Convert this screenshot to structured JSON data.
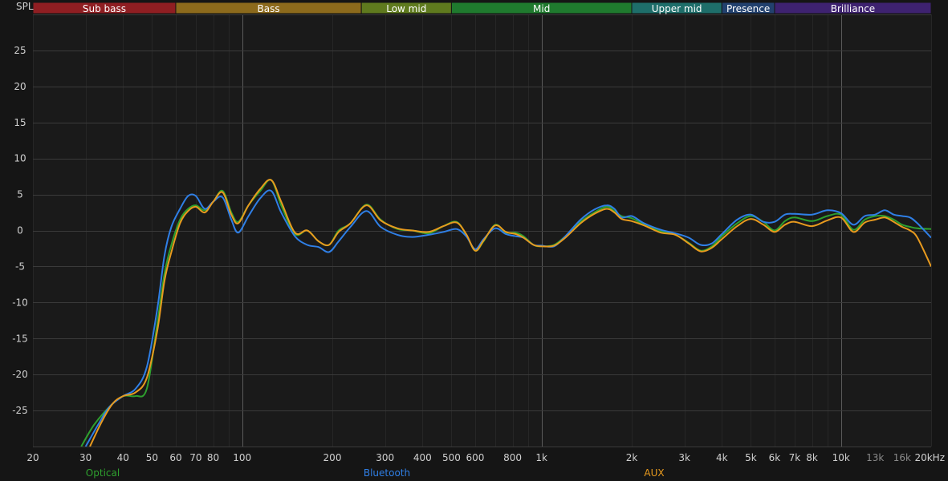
{
  "colors": {
    "background": "#151515",
    "plot_background": "#1a1a1a",
    "grid_major": "#3a3a3a",
    "grid_minor": "#262626",
    "decade_line": "#5a5a5a"
  },
  "chart_data": {
    "type": "line",
    "ylabel": "SPL",
    "xscale": "log",
    "xlim": [
      20,
      20000
    ],
    "ylim": [
      -30,
      30
    ],
    "grid": true,
    "legend_position": "bottom",
    "y_ticks": [
      25,
      20,
      15,
      10,
      5,
      0,
      -5,
      -10,
      -15,
      -20,
      -25
    ],
    "x_ticks": [
      {
        "value": 20,
        "label": "20"
      },
      {
        "value": 30,
        "label": "30"
      },
      {
        "value": 40,
        "label": "40"
      },
      {
        "value": 50,
        "label": "50"
      },
      {
        "value": 60,
        "label": "60"
      },
      {
        "value": 70,
        "label": "70"
      },
      {
        "value": 80,
        "label": "80"
      },
      {
        "value": 100,
        "label": "100"
      },
      {
        "value": 200,
        "label": "200"
      },
      {
        "value": 300,
        "label": "300"
      },
      {
        "value": 400,
        "label": "400"
      },
      {
        "value": 500,
        "label": "500"
      },
      {
        "value": 600,
        "label": "600"
      },
      {
        "value": 800,
        "label": "800"
      },
      {
        "value": 1000,
        "label": "1k"
      },
      {
        "value": 2000,
        "label": "2k"
      },
      {
        "value": 3000,
        "label": "3k"
      },
      {
        "value": 4000,
        "label": "4k"
      },
      {
        "value": 5000,
        "label": "5k"
      },
      {
        "value": 6000,
        "label": "6k"
      },
      {
        "value": 7000,
        "label": "7k"
      },
      {
        "value": 8000,
        "label": "8k"
      },
      {
        "value": 10000,
        "label": "10k"
      },
      {
        "value": 13000,
        "label": "13k",
        "dim": true
      },
      {
        "value": 16000,
        "label": "16k",
        "dim": true
      },
      {
        "value": 20000,
        "label": "20kHz"
      }
    ],
    "bands": [
      {
        "label": "Sub bass",
        "from": 20,
        "to": 60,
        "color": "#8f1e22"
      },
      {
        "label": "Bass",
        "from": 60,
        "to": 250,
        "color": "#8c6a1c"
      },
      {
        "label": "Low mid",
        "from": 250,
        "to": 500,
        "color": "#5f7a1e"
      },
      {
        "label": "Mid",
        "from": 500,
        "to": 2000,
        "color": "#1f7a2e"
      },
      {
        "label": "Upper mid",
        "from": 2000,
        "to": 4000,
        "color": "#1e6e6a"
      },
      {
        "label": "Presence",
        "from": 4000,
        "to": 6000,
        "color": "#22416e"
      },
      {
        "label": "Brilliance",
        "from": 6000,
        "to": 20000,
        "color": "#3e2270"
      }
    ],
    "series": [
      {
        "name": "Optical",
        "color": "#2ea02e",
        "x": [
          29,
          32,
          36,
          40,
          44,
          48,
          52,
          55,
          58,
          62,
          66,
          70,
          75,
          80,
          86,
          92,
          97,
          105,
          115,
          125,
          135,
          150,
          165,
          180,
          195,
          210,
          230,
          260,
          290,
          330,
          370,
          420,
          470,
          520,
          560,
          600,
          640,
          700,
          760,
          820,
          870,
          940,
          1000,
          1100,
          1200,
          1350,
          1500,
          1650,
          1750,
          1850,
          2000,
          2200,
          2500,
          2800,
          3100,
          3400,
          3700,
          4000,
          4500,
          5000,
          5500,
          6000,
          6500,
          7000,
          8000,
          9000,
          10000,
          11000,
          12000,
          13000,
          14000,
          15000,
          16000,
          17000,
          18000,
          20000
        ],
        "y": [
          -30,
          -27,
          -24.5,
          -23,
          -23,
          -22,
          -13,
          -6,
          -2,
          1.5,
          3,
          3.5,
          2.8,
          4,
          5.5,
          2.5,
          1.2,
          3.5,
          5.5,
          7,
          3.5,
          -0.5,
          0,
          -1.5,
          -2,
          0,
          1,
          3.6,
          1.5,
          0.2,
          0,
          -0.4,
          0.6,
          1.2,
          -0.6,
          -2.8,
          -1.5,
          0.8,
          -0.3,
          -0.3,
          -0.8,
          -2,
          -2.2,
          -2,
          -0.8,
          1.2,
          2.5,
          3.3,
          2.7,
          2,
          1.7,
          0.8,
          -0.1,
          -0.6,
          -1.7,
          -2.8,
          -2.2,
          -0.8,
          1,
          2,
          1.2,
          0,
          1.3,
          1.8,
          1.3,
          2,
          2.2,
          0.1,
          1.5,
          2,
          2,
          1.5,
          0.8,
          0.5,
          0.3,
          0.2
        ]
      },
      {
        "name": "Bluetooth",
        "color": "#2f7fe6",
        "x": [
          30,
          33,
          36,
          40,
          44,
          48,
          52,
          55,
          58,
          62,
          66,
          70,
          75,
          80,
          86,
          92,
          97,
          105,
          115,
          125,
          135,
          150,
          165,
          180,
          195,
          210,
          230,
          260,
          290,
          330,
          370,
          420,
          470,
          520,
          560,
          600,
          640,
          700,
          760,
          820,
          870,
          940,
          1000,
          1100,
          1200,
          1350,
          1500,
          1650,
          1750,
          1850,
          2000,
          2200,
          2500,
          2800,
          3100,
          3400,
          3700,
          4000,
          4500,
          5000,
          5500,
          6000,
          6500,
          7000,
          8000,
          9000,
          10000,
          11000,
          12000,
          13000,
          14000,
          15000,
          16000,
          17000,
          18000,
          20000
        ],
        "y": [
          -30,
          -27,
          -24.5,
          -23,
          -22,
          -19,
          -11,
          -3.5,
          0.5,
          3,
          4.8,
          4.8,
          3,
          4,
          4.6,
          1.5,
          -0.3,
          2,
          4.5,
          5.5,
          2.5,
          -0.8,
          -2,
          -2.3,
          -3,
          -1.5,
          0.5,
          2.7,
          0.5,
          -0.6,
          -0.9,
          -0.6,
          -0.2,
          0.2,
          -0.8,
          -2.6,
          -1.2,
          0.3,
          -0.5,
          -0.8,
          -1,
          -2,
          -2.1,
          -2.2,
          -0.8,
          1.5,
          2.9,
          3.5,
          3,
          1.8,
          2,
          1,
          0.1,
          -0.4,
          -1,
          -2,
          -1.8,
          -0.5,
          1.5,
          2.2,
          1.2,
          1.2,
          2.2,
          2.3,
          2.2,
          2.8,
          2.4,
          0.8,
          2,
          2.2,
          2.8,
          2.2,
          2,
          1.8,
          1,
          -1
        ]
      },
      {
        "name": "AUX",
        "color": "#e89a1e",
        "x": [
          31,
          34,
          37,
          40,
          44,
          48,
          52,
          55,
          58,
          62,
          66,
          70,
          75,
          80,
          86,
          92,
          97,
          105,
          115,
          125,
          135,
          150,
          165,
          180,
          195,
          210,
          230,
          260,
          290,
          330,
          370,
          420,
          470,
          520,
          560,
          600,
          640,
          700,
          760,
          820,
          870,
          940,
          1000,
          1100,
          1200,
          1350,
          1500,
          1650,
          1750,
          1850,
          2000,
          2200,
          2500,
          2800,
          3100,
          3400,
          3700,
          4000,
          4500,
          5000,
          5500,
          6000,
          6500,
          7000,
          8000,
          9000,
          10000,
          11000,
          12000,
          13000,
          14000,
          15000,
          16000,
          17000,
          18000,
          20000
        ],
        "y": [
          -30,
          -26.5,
          -24,
          -23,
          -22.5,
          -20.5,
          -14,
          -7,
          -3,
          1,
          2.7,
          3.3,
          2.5,
          4,
          5.3,
          2.2,
          1,
          3.5,
          5.8,
          7,
          4,
          -0.3,
          0,
          -1.5,
          -2,
          -0.2,
          1,
          3.5,
          1.4,
          0.3,
          0,
          -0.2,
          0.6,
          1.1,
          -0.5,
          -2.8,
          -1.4,
          0.7,
          -0.2,
          -0.5,
          -1,
          -2,
          -2.2,
          -2.1,
          -1,
          1,
          2.3,
          3,
          2.5,
          1.6,
          1.3,
          0.7,
          -0.3,
          -0.6,
          -1.8,
          -2.9,
          -2.4,
          -1.2,
          0.6,
          1.6,
          0.8,
          -0.2,
          0.8,
          1.2,
          0.6,
          1.4,
          1.8,
          -0.2,
          1.1,
          1.5,
          1.8,
          1.2,
          0.5,
          0,
          -1,
          -5
        ]
      }
    ]
  }
}
